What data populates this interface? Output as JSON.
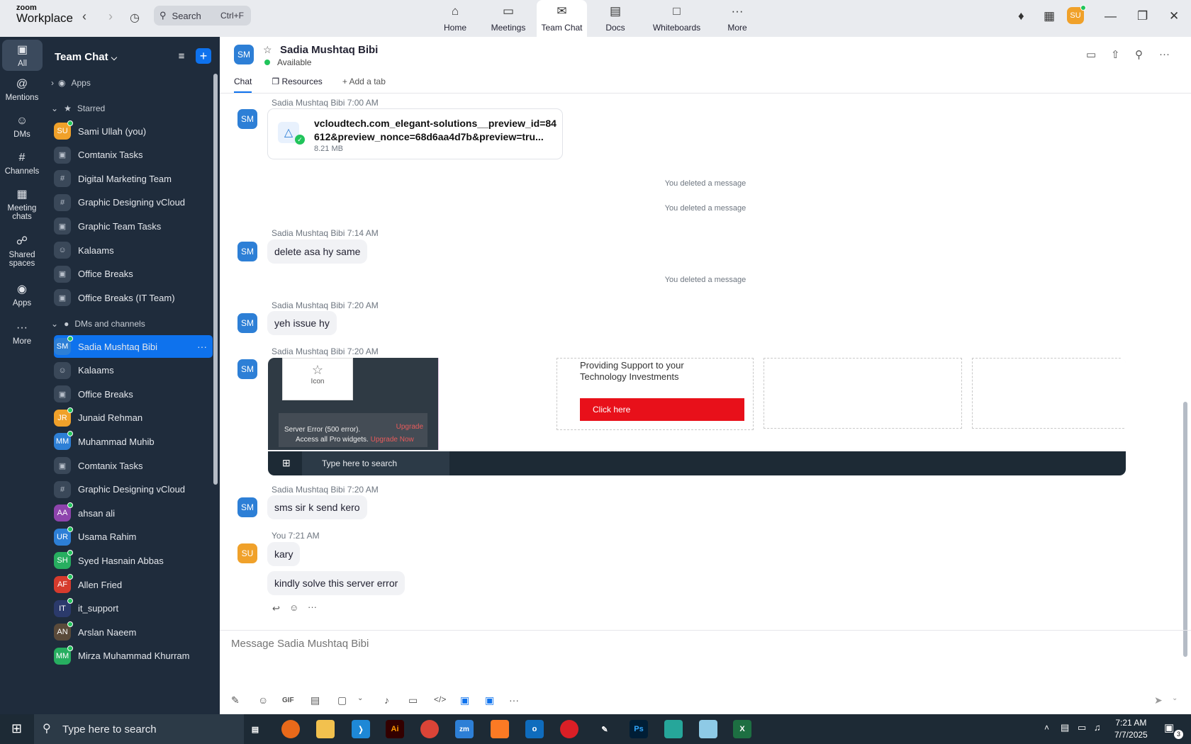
{
  "app": {
    "logo_top": "zoom",
    "logo_bottom": "Workplace"
  },
  "search": {
    "label": "Search",
    "shortcut": "Ctrl+F"
  },
  "tabs": [
    {
      "label": "Home",
      "icon": "home-icon"
    },
    {
      "label": "Meetings",
      "icon": "video-icon"
    },
    {
      "label": "Team Chat",
      "icon": "chat-icon"
    },
    {
      "label": "Docs",
      "icon": "doc-icon"
    },
    {
      "label": "Whiteboards",
      "icon": "whiteboard-icon"
    },
    {
      "label": "More",
      "icon": "more-icon"
    }
  ],
  "user": {
    "initials": "SU",
    "color": "#f0a12a"
  },
  "rail": [
    {
      "label": "All"
    },
    {
      "label": "Mentions"
    },
    {
      "label": "DMs"
    },
    {
      "label": "Channels"
    },
    {
      "label": "Meeting chats"
    },
    {
      "label": "Shared spaces"
    },
    {
      "label": "Apps"
    },
    {
      "label": "More"
    }
  ],
  "sidebar": {
    "title": "Team Chat",
    "apps_label": "Apps",
    "starred_label": "Starred",
    "starred": [
      {
        "label": "Sami Ullah (you)",
        "initials": "SU",
        "color": "#f0a12a",
        "kind": "avatar"
      },
      {
        "label": "Comtanix Tasks",
        "kind": "lock"
      },
      {
        "label": "Digital Marketing Team",
        "kind": "hash"
      },
      {
        "label": "Graphic Designing vCloud",
        "kind": "hash"
      },
      {
        "label": "Graphic Team Tasks",
        "kind": "lock"
      },
      {
        "label": "Kalaams",
        "kind": "group"
      },
      {
        "label": "Office Breaks",
        "kind": "lock"
      },
      {
        "label": "Office Breaks (IT Team)",
        "kind": "lock"
      }
    ],
    "dms_label": "DMs and channels",
    "dms": [
      {
        "label": "Sadia Mushtaq Bibi",
        "initials": "SM",
        "color": "#2d7fd6",
        "kind": "avatar"
      },
      {
        "label": "Kalaams",
        "kind": "group"
      },
      {
        "label": "Office Breaks",
        "kind": "lock"
      },
      {
        "label": "Junaid Rehman",
        "initials": "JR",
        "color": "#f0a12a",
        "kind": "avatar"
      },
      {
        "label": "Muhammad Muhib",
        "initials": "MM",
        "color": "#2d7fd6",
        "kind": "avatar"
      },
      {
        "label": "Comtanix Tasks",
        "kind": "lock"
      },
      {
        "label": "Graphic Designing vCloud",
        "kind": "hash"
      },
      {
        "label": "ahsan ali",
        "initials": "AA",
        "color": "#8e44ad",
        "kind": "avatar"
      },
      {
        "label": "Usama Rahim",
        "initials": "UR",
        "color": "#2d7fd6",
        "kind": "avatar"
      },
      {
        "label": "Syed Hasnain Abbas",
        "initials": "SH",
        "color": "#27ae60",
        "kind": "avatar"
      },
      {
        "label": "Allen Fried",
        "initials": "AF",
        "color": "#d63b2d",
        "kind": "avatar"
      },
      {
        "label": "it_support",
        "initials": "IT",
        "color": "#2b3a6b",
        "kind": "avatar"
      },
      {
        "label": "Arslan Naeem",
        "initials": "AN",
        "color": "#5a4a3a",
        "kind": "avatar"
      },
      {
        "label": "Mirza Muhammad Khurram",
        "initials": "MM",
        "color": "#27ae60",
        "kind": "avatar"
      }
    ]
  },
  "chat": {
    "contact": "Sadia Mushtaq Bibi",
    "initials": "SM",
    "status": "Available",
    "tabs": [
      "Chat",
      "Resources",
      "Add a tab"
    ],
    "messages": {
      "m1_meta": "Sadia Mushtaq Bibi 7:00 AM",
      "file_name_1": "vcloudtech.com_elegant-solutions__preview_id=84",
      "file_name_2": "612&preview_nonce=68d6aa4d7b&preview=tru...",
      "file_size": "8.21 MB",
      "deleted": "You deleted a message",
      "m2_meta": "Sadia Mushtaq Bibi 7:14 AM",
      "m2_text": "delete asa hy same",
      "m3_meta": "Sadia Mushtaq Bibi 7:20 AM",
      "m3_text": "yeh issue hy",
      "m4_meta": "Sadia Mushtaq Bibi 7:20 AM",
      "m5_meta": "Sadia Mushtaq Bibi 7:20 AM",
      "m5_text": "sms sir k send kero",
      "m6_meta": "You 7:21 AM",
      "m6_text1": "kary",
      "m6_text2": "kindly solve this server error"
    },
    "screenshot": {
      "icon_label": "Icon",
      "promo_line1": "Providing Support to your",
      "promo_line2": "Technology Investments",
      "button": "Click here",
      "error": "Server Error (500 error).",
      "pro_text": "Access all Pro widgets.",
      "upgrade": "Upgrade Now",
      "upgrade_short": "Upgrade",
      "task_search": "Type here to search"
    },
    "composer_placeholder": "Message Sadia Mushtaq Bibi"
  },
  "taskbar": {
    "search_placeholder": "Type here to search",
    "time": "7:21 AM",
    "date": "7/7/2025",
    "notif_count": "3"
  }
}
